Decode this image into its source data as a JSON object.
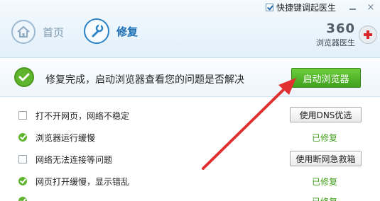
{
  "topbar": {
    "startup_label": "快捷键调起医生",
    "minimize_icon": "minimize-icon",
    "close_symbol": "×"
  },
  "nav": {
    "home_label": "首页",
    "repair_label": "修复"
  },
  "brand": {
    "name": "360",
    "subtitle": "浏览器医生"
  },
  "status": {
    "message": "修复完成，启动浏览器查看您的问题是否解决",
    "launch_button": "启动浏览器"
  },
  "issues": [
    {
      "label": "打不开网页，网络不稳定",
      "state": "unchecked",
      "action": "使用DNS优选"
    },
    {
      "label": "浏览器运行缓慢",
      "state": "fixed",
      "status": "已修复"
    },
    {
      "label": "网络无法连接等问题",
      "state": "unchecked",
      "action": "使用断网急救箱"
    },
    {
      "label": "网页打开缓慢，显示错乱",
      "state": "fixed",
      "status": "已修复"
    },
    {
      "label": "",
      "state": "fixed",
      "status": "已修复"
    }
  ],
  "colors": {
    "accent_blue": "#1b6fb5",
    "success_green": "#3f9e1a",
    "arrow_red": "#e03030"
  }
}
